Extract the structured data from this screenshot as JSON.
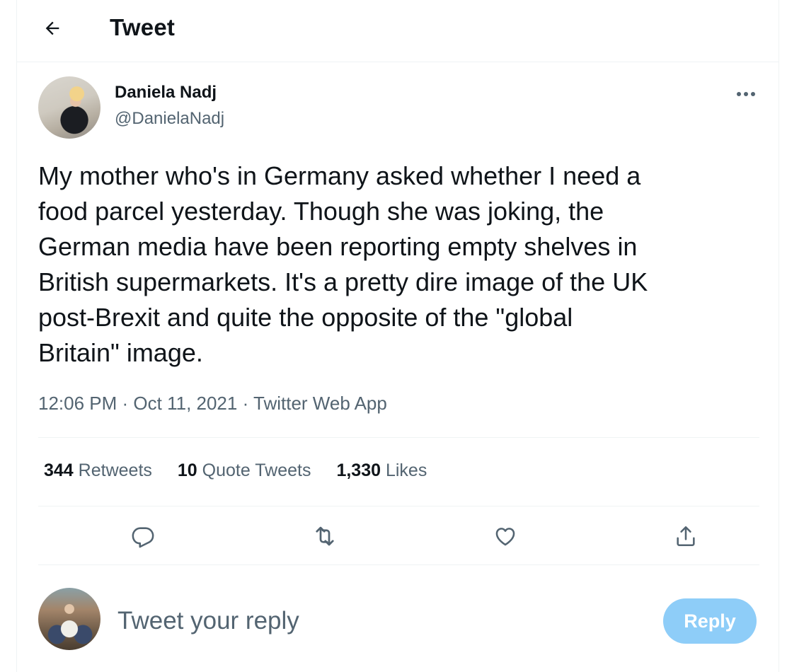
{
  "header": {
    "title": "Tweet",
    "back_icon": "arrow-left-icon"
  },
  "tweet": {
    "author": {
      "name": "Daniela Nadj",
      "handle": "@DanielaNadj"
    },
    "more_icon": "more-horizontal-icon",
    "text": "My mother who's in Germany asked whether I need a\nfood parcel yesterday. Though she was joking, the\nGerman media have been reporting empty shelves in\nBritish supermarkets. It's a pretty dire image of the UK\npost-Brexit and quite the opposite of the \"global\nBritain\" image.",
    "time": "12:06 PM",
    "date": "Oct 11, 2021",
    "source": "Twitter Web App",
    "separator": " · "
  },
  "stats": {
    "retweets_count": "344",
    "retweets_label": "Retweets",
    "quotes_count": "10",
    "quotes_label": "Quote Tweets",
    "likes_count": "1,330",
    "likes_label": "Likes"
  },
  "actions": [
    {
      "icon": "reply-icon"
    },
    {
      "icon": "retweet-icon"
    },
    {
      "icon": "like-icon"
    },
    {
      "icon": "share-icon"
    }
  ],
  "composer": {
    "placeholder": "Tweet your reply",
    "button_label": "Reply"
  },
  "colors": {
    "text_primary": "#0f1419",
    "text_secondary": "#536471",
    "divider": "#eff3f4",
    "reply_button_disabled": "#8ecdf8"
  }
}
